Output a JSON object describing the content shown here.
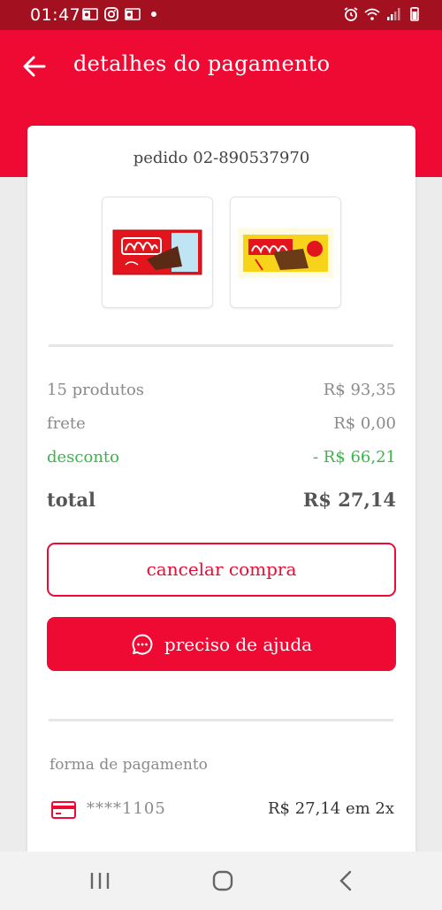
{
  "status_bar": {
    "time": "01:47",
    "left_icons": [
      "outlook-icon",
      "instagram-icon",
      "outlook-icon"
    ],
    "right_icons": [
      "alarm-icon",
      "wifi-icon",
      "signal-icon",
      "battery-icon"
    ]
  },
  "header": {
    "title": "detalhes do pagamento"
  },
  "order": {
    "label": "pedido 02-890537970",
    "products": [
      {
        "name": "Nestlé Classic",
        "icon": "nestle-chocolate-bar"
      },
      {
        "name": "Garoto",
        "icon": "garoto-chocolate-bar"
      }
    ]
  },
  "summary": {
    "products_label": "15 produtos",
    "products_value": "R$ 93,35",
    "shipping_label": "frete",
    "shipping_value": "R$ 0,00",
    "discount_label": "desconto",
    "discount_value": "- R$ 66,21",
    "total_label": "total",
    "total_value": "R$ 27,14"
  },
  "actions": {
    "cancel_label": "cancelar compra",
    "help_label": "preciso de ajuda"
  },
  "payment": {
    "heading": "forma de pagamento",
    "card_mask": "****1105",
    "amount": "R$ 27,14 em 2x"
  },
  "colors": {
    "brand_red": "#ee0a32",
    "status_bar": "#a3101f",
    "discount_green": "#3ab54a"
  },
  "nav_bar": {
    "buttons": [
      "recent-apps-icon",
      "home-icon",
      "back-icon"
    ]
  }
}
